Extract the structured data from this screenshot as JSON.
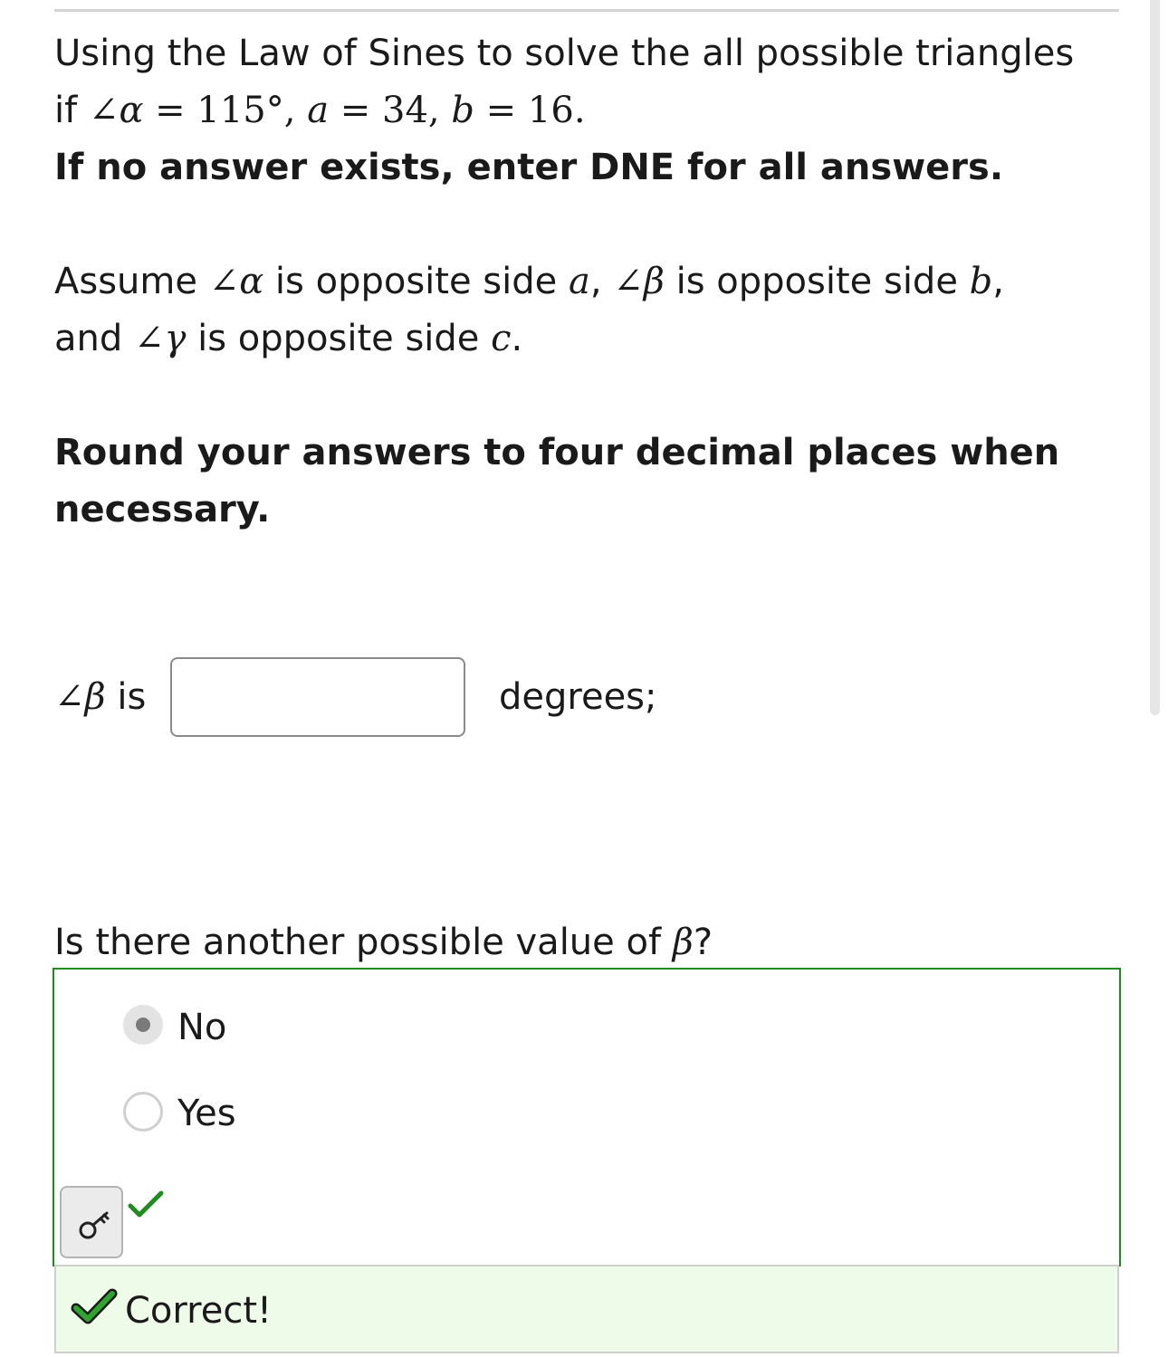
{
  "question": {
    "line1": "Using the Law of Sines to solve the all possible triangles",
    "line2": {
      "if": "if ",
      "angle": "∠",
      "alpha": "α",
      "eq1": " = ",
      "alpha_val": "115°",
      "comma1": ", ",
      "a": "a",
      "eq2": " = ",
      "a_val": "34",
      "comma2": ", ",
      "b": "b",
      "eq3": " = ",
      "b_val": "16."
    },
    "instruction": "If no answer exists, enter DNE for all answers."
  },
  "assumption": {
    "l1_a": "Assume ",
    "angle": "∠",
    "alpha": "α",
    "l1_b": " is opposite side ",
    "side_a": "a",
    "comma": ", ",
    "beta": "β",
    "l1_c": " is opposite side ",
    "side_b": "b",
    "l1_end": ",",
    "l2_a": "and ",
    "gamma": "γ",
    "l2_b": " is opposite side ",
    "side_c": "c",
    "l2_end": "."
  },
  "rounding": {
    "line1": "Round your answers to four decimal places when",
    "line2": "necessary."
  },
  "beta_answer": {
    "angle": "∠",
    "beta": "β",
    "is_text": " is",
    "value": "",
    "unit": "degrees;"
  },
  "another_value": {
    "prompt_text": "Is there another possible value of ",
    "beta": "β",
    "question_mark": "?",
    "options": [
      "No",
      "Yes"
    ],
    "selected": "No"
  },
  "feedback": {
    "message": "Correct!"
  },
  "colors": {
    "correct_green": "#1e8c1e",
    "feedback_bg": "#effbe9"
  },
  "icons": {
    "key_button": "key-icon",
    "inline_check": "checkmark-icon",
    "feedback_check": "checkmark-icon"
  }
}
